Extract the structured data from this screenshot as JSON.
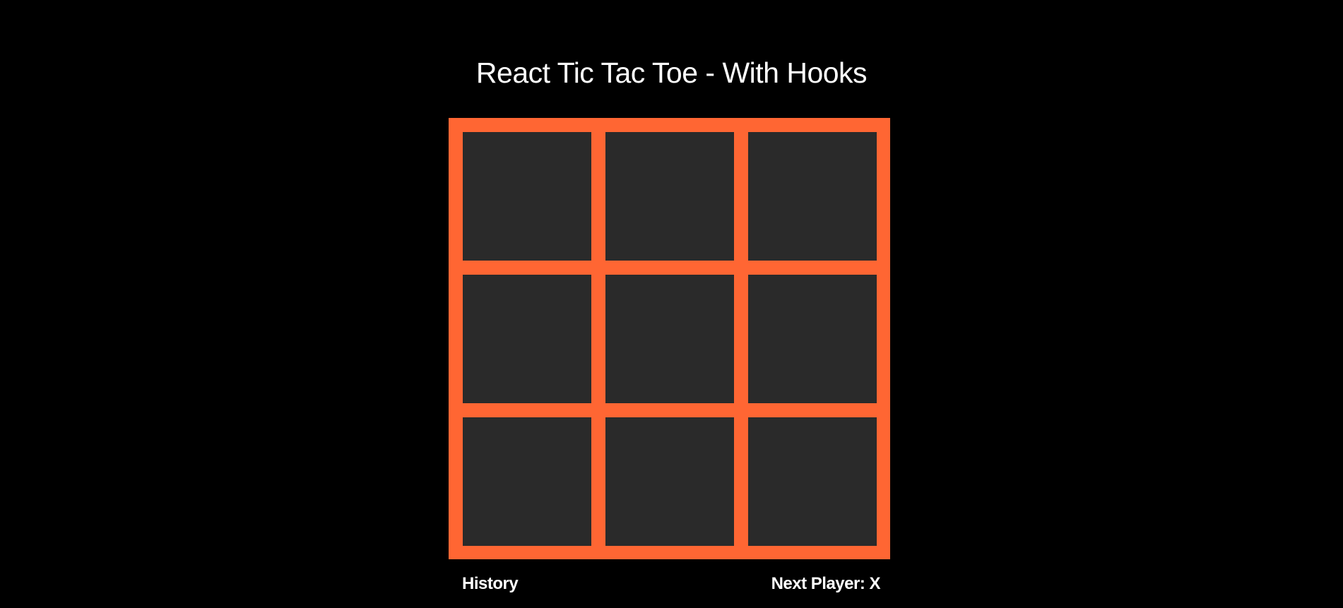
{
  "header": {
    "title": "React Tic Tac Toe - With Hooks"
  },
  "board": {
    "squares": [
      "",
      "",
      "",
      "",
      "",
      "",
      "",
      "",
      ""
    ]
  },
  "footer": {
    "history_label": "History",
    "status": "Next Player: X"
  },
  "colors": {
    "background": "#000000",
    "board_frame": "#ff6633",
    "square": "#2a2a2a",
    "text": "#ffffff"
  }
}
